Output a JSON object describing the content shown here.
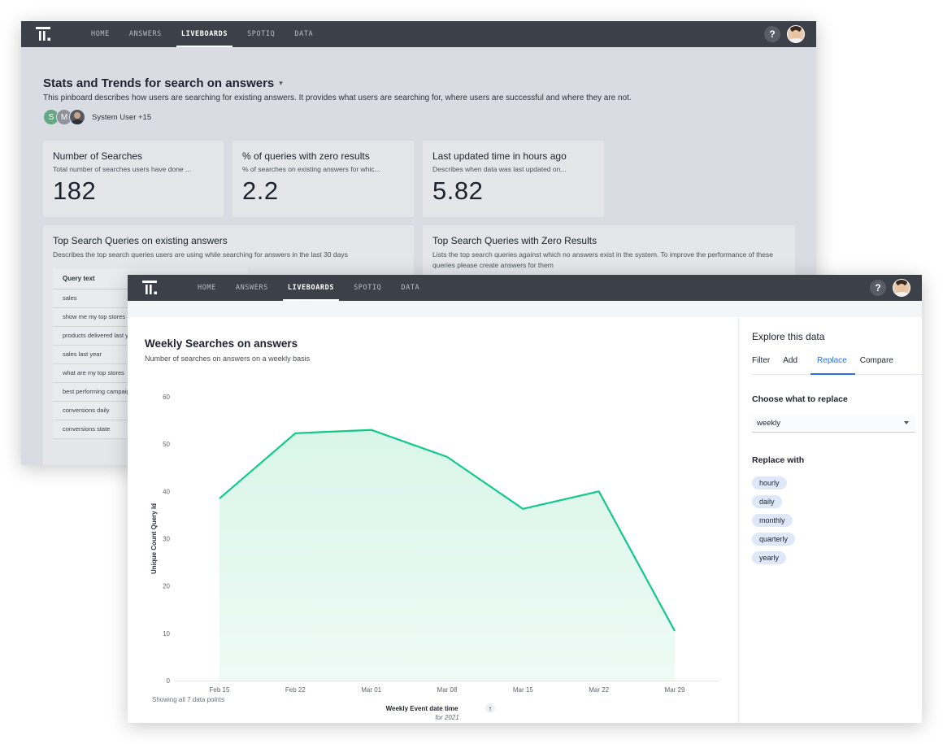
{
  "nav": {
    "tabs": [
      "HOME",
      "ANSWERS",
      "LIVEBOARDS",
      "SPOTIQ",
      "DATA"
    ],
    "active": "LIVEBOARDS",
    "help": "?"
  },
  "back": {
    "title": "Stats and Trends for search on answers",
    "description": "This pinboard describes how users are searching for existing answers. It provides what users are searching for, where users are successful and where they are not.",
    "user_initials": [
      "S",
      "M"
    ],
    "users_label": "System User +15",
    "kpis": [
      {
        "title": "Number of Searches",
        "sub": "Total number of searches users have done ...",
        "value": "182"
      },
      {
        "title": "% of queries with zero results",
        "sub": "% of searches on existing answers for whic...",
        "value": "2.2"
      },
      {
        "title": "Last updated time in hours ago",
        "sub": "Describes when data was last updated on...",
        "value": "5.82"
      }
    ],
    "top_queries": {
      "title": "Top Search Queries on existing answers",
      "sub": "Describes the top search queries users are using while searching for answers in the last 30 days",
      "column": "Query text",
      "rows": [
        "sales",
        "show me my top stores",
        "products delivered last year",
        "sales last year",
        "what are my top stores",
        "best performing campaigns",
        "conversions daily",
        "conversions state"
      ]
    },
    "zero_results": {
      "title": "Top Search Queries with Zero Results",
      "sub": "Lists the top search queries against which no answers exist in the system. To improve the performance of these queries please create answers for them"
    }
  },
  "front": {
    "chart_title": "Weekly Searches on answers",
    "chart_sub": "Number of searches on answers on a weekly basis",
    "points_note": "Showing all 7 data points",
    "sort_icon": "↑",
    "explore": {
      "title": "Explore this data",
      "tabs": [
        "Filter",
        "Add",
        "Replace",
        "Compare"
      ],
      "active_tab": "Replace",
      "choose_label": "Choose what to replace",
      "selected": "weekly",
      "replace_label": "Replace with",
      "options": [
        "hourly",
        "daily",
        "monthly",
        "quarterly",
        "yearly"
      ]
    }
  },
  "chart_data": {
    "type": "area",
    "title": "Weekly Searches on answers",
    "subtitle": "Number of searches on answers on a weekly basis",
    "categories": [
      "Feb 15",
      "Feb 22",
      "Mar 01",
      "Mar 08",
      "Mar 15",
      "Mar 22",
      "Mar 29"
    ],
    "values": [
      38.5,
      52.3,
      53,
      47.3,
      36.3,
      40,
      10.5
    ],
    "xlabel": "Weekly Event date time",
    "xsublabel": "for 2021",
    "ylabel": "Unique Count Query Id",
    "yticks": [
      0,
      10,
      20,
      30,
      40,
      50,
      60
    ],
    "ylim": [
      0,
      60
    ],
    "line_color": "#12c98a",
    "fill_color": "#d9f5ea",
    "grid": false
  }
}
